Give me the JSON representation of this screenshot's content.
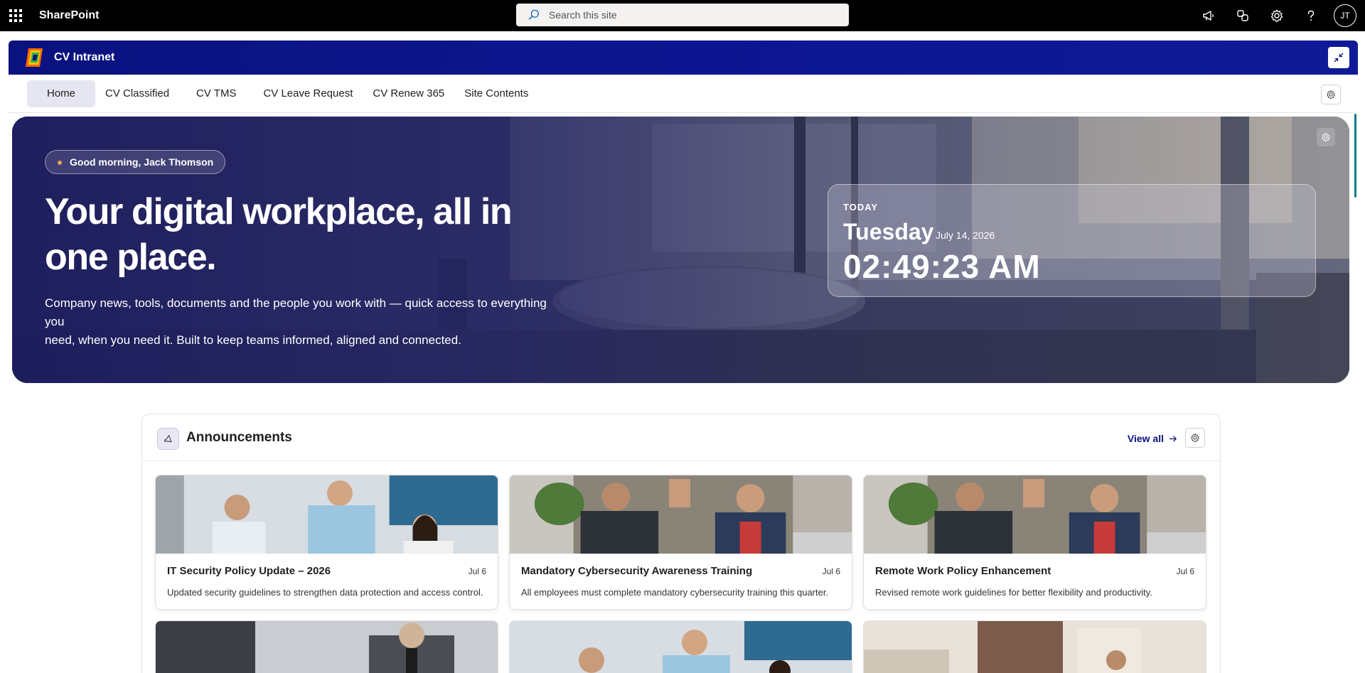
{
  "suite": {
    "app_name": "SharePoint",
    "search_placeholder": "Search this site",
    "icons": [
      "waffle-icon",
      "megaphone-icon",
      "share-icon",
      "settings-icon",
      "help-icon"
    ],
    "avatar_initials": "JT"
  },
  "site": {
    "title": "CV Intranet"
  },
  "nav": {
    "items": [
      {
        "label": "Home",
        "active": true
      },
      {
        "label": "CV Classified"
      },
      {
        "label": "CV TMS"
      },
      {
        "label": "CV Leave Request"
      },
      {
        "label": "CV Renew 365"
      },
      {
        "label": "Site Contents"
      }
    ]
  },
  "hero": {
    "greeting": "Good morning, Jack Thomson",
    "title_line1": "Your digital workplace, all in",
    "title_line2": "one place.",
    "subtitle_line1": "Company news, tools, documents and the people you work with — quick access to everything you",
    "subtitle_line2": "need, when you need it. Built to keep teams informed, aligned and connected.",
    "clock": {
      "label": "TODAY",
      "day": "Tuesday",
      "date": "July 14, 2026",
      "time": "02:49:23 AM"
    }
  },
  "announcements": {
    "title": "Announcements",
    "view_all": "View all",
    "cards": [
      {
        "title": "IT Security Policy Update – 2026",
        "date": "Jul 6",
        "description": "Updated security guidelines to strengthen data protection and access control."
      },
      {
        "title": "Mandatory Cybersecurity Awareness Training",
        "date": "Jul 6",
        "description": "All employees must complete mandatory cybersecurity training this quarter."
      },
      {
        "title": "Remote Work Policy Enhancement",
        "date": "Jul 6",
        "description": "Revised remote work guidelines for better flexibility and productivity."
      }
    ]
  },
  "colors": {
    "brand_navy": "#0a127e",
    "suite_bar": "#000000",
    "accent_teal": "#0e7c86"
  }
}
